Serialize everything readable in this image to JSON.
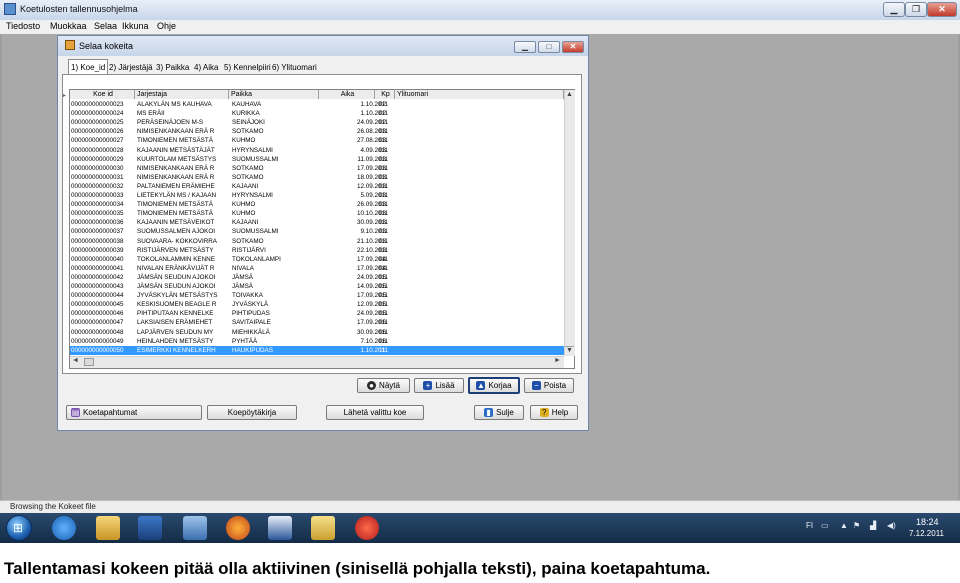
{
  "app": {
    "title": "Koetulosten tallennusohjelma"
  },
  "menu": [
    "Tiedosto",
    "Muokkaa",
    "Selaa",
    "Ikkuna",
    "Ohje"
  ],
  "dialog": {
    "title": "Selaa kokeita"
  },
  "tabs": [
    "1) Koe_id",
    "2) Järjestäjä",
    "3) Paikka",
    "4) Aika",
    "5) Kennelpiiri",
    "6) Ylituomari"
  ],
  "grid": {
    "columns": [
      "Koe id",
      "Jarjestaja",
      "Paikka",
      "Aika",
      "Kp",
      "Ylituomari"
    ],
    "rows": [
      [
        "000000000000023",
        "ALAKYLÄN MS KAUHAVA",
        "KAUHAVA",
        "1.10.2011",
        "02"
      ],
      [
        "000000000000024",
        "MS ERÄII",
        "KURIKKA",
        "1.10.2011",
        "02"
      ],
      [
        "000000000000025",
        "PERÄSEINÄJOEN M-S",
        "SEINÄJOKI",
        "24.09.2011",
        "02"
      ],
      [
        "000000000000026",
        "NIMISENKANKAAN ERÄ R",
        "SOTKAMO",
        "26.08.2011",
        "03"
      ],
      [
        "000000000000027",
        "TIMONIEMEN METSÄSTÄ",
        "KUHMO",
        "27.08.2011",
        "03"
      ],
      [
        "000000000000028",
        "KAJAANIN METSÄSTÄJÄT",
        "HYRYNSALMI",
        "4.09.2011",
        "03"
      ],
      [
        "000000000000029",
        "KUURTOLAM METSÄSTYS",
        "SUOMUSSALMI",
        "11.09.2011",
        "03"
      ],
      [
        "000000000000030",
        "NIMISENKANKAAN ERÄ R",
        "SOTKAMO",
        "17.09.2011",
        "03"
      ],
      [
        "000000000000031",
        "NIMISENKANKAAN ERÄ R",
        "SOTKAMO",
        "18.09.2011",
        "03"
      ],
      [
        "000000000000032",
        "PALTANIEMEN ERÄMIEHE",
        "KAJAANI",
        "12.09.2011",
        "03"
      ],
      [
        "000000000000033",
        "LIETEKYLÄN MS / KAJAAN",
        "HYRYNSALMI",
        "5.09.2011",
        "03"
      ],
      [
        "000000000000034",
        "TIMONIEMEN METSÄSTÄ",
        "KUHMO",
        "26.09.2011",
        "03"
      ],
      [
        "000000000000035",
        "TIMONIEMEN METSÄSTÄ",
        "KUHMO",
        "10.10.2011",
        "03"
      ],
      [
        "000000000000036",
        "KAJAANIN METSÄVEIKOT",
        "KAJAANI",
        "30.09.2011",
        "03"
      ],
      [
        "000000000000037",
        "SUOMUSSALMEN AJOKOI",
        "SUOMUSSALMI",
        "9.10.2011",
        "03"
      ],
      [
        "000000000000038",
        "SUOVAARA- KOKKOVIRRA",
        "SOTKAMO",
        "21.10.2011",
        "03"
      ],
      [
        "000000000000039",
        "RISTIJÄRVEN METSÄSTY",
        "RISTIJÄRVI",
        "22.10.2011",
        "03"
      ],
      [
        "000000000000040",
        "TOKOLANLAMMIN KENNE",
        "TOKOLANLAMPI",
        "17.09.2011",
        "04"
      ],
      [
        "000000000000041",
        "NIVALAN ERÄNKÄVIJÄT R",
        "NIVALA",
        "17.09.2011",
        "04"
      ],
      [
        "000000000000042",
        "JÄMSÄN SEUDUN AJOKOI",
        "JÄMSÄ",
        "24.09.2011",
        "05"
      ],
      [
        "000000000000043",
        "JÄMSÄN SEUDUN AJOKOI",
        "JÄMSÄ",
        "14.09.2011",
        "05"
      ],
      [
        "000000000000044",
        "JYVÄSKYLÄN METSÄSTYS",
        "TOIVAKKA",
        "17.09.2011",
        "05"
      ],
      [
        "000000000000045",
        "KESKISUOMEN BEAGLE R",
        "JYVÄSKYLÄ",
        "12.09.2011",
        "05"
      ],
      [
        "000000000000046",
        "PIHTIPUTAAN KENNELKE",
        "PIHTIPUDAS",
        "24.09.2011",
        "05"
      ],
      [
        "000000000000047",
        "LAKSIAISEN ERÄMIEHET",
        "SAVITAIPALE",
        "17.09.2011",
        "06"
      ],
      [
        "000000000000048",
        "LAPJÄRVEN SEUDUN MY",
        "MIEHIKKÄLÄ",
        "30.09.2011",
        "06"
      ],
      [
        "000000000000049",
        "HEINLAHDEN METSÄSTY",
        "PYHTÄÄ",
        "7.10.2011",
        "06"
      ],
      [
        "000000000000050",
        "ESIMERKKI KENNELKERH",
        "HAUKIPUDAS",
        "1.10.2011",
        "11"
      ]
    ],
    "selected_index": 27
  },
  "buttons": {
    "nayta": "Näytä",
    "lisaa": "Lisää",
    "korjaa": "Korjaa",
    "poista": "Poista",
    "koetapahtumat": "Koetapahtumat",
    "koepoytakirja": "Koepöytäkirja",
    "laheta": "Lähetä valittu koe",
    "sulje": "Sulje",
    "help": "Help"
  },
  "status": {
    "text": "Browsing the Kokeet file"
  },
  "taskbar": {
    "lang": "FI",
    "time": "18:24",
    "date": "7.12.2011"
  },
  "caption": "Tallentamasi kokeen pitää olla aktiivinen (sinisellä pohjalla teksti), paina koetapahtuma.",
  "colors": {
    "selection": "#3399ff",
    "taskbar": "#1b3554"
  }
}
